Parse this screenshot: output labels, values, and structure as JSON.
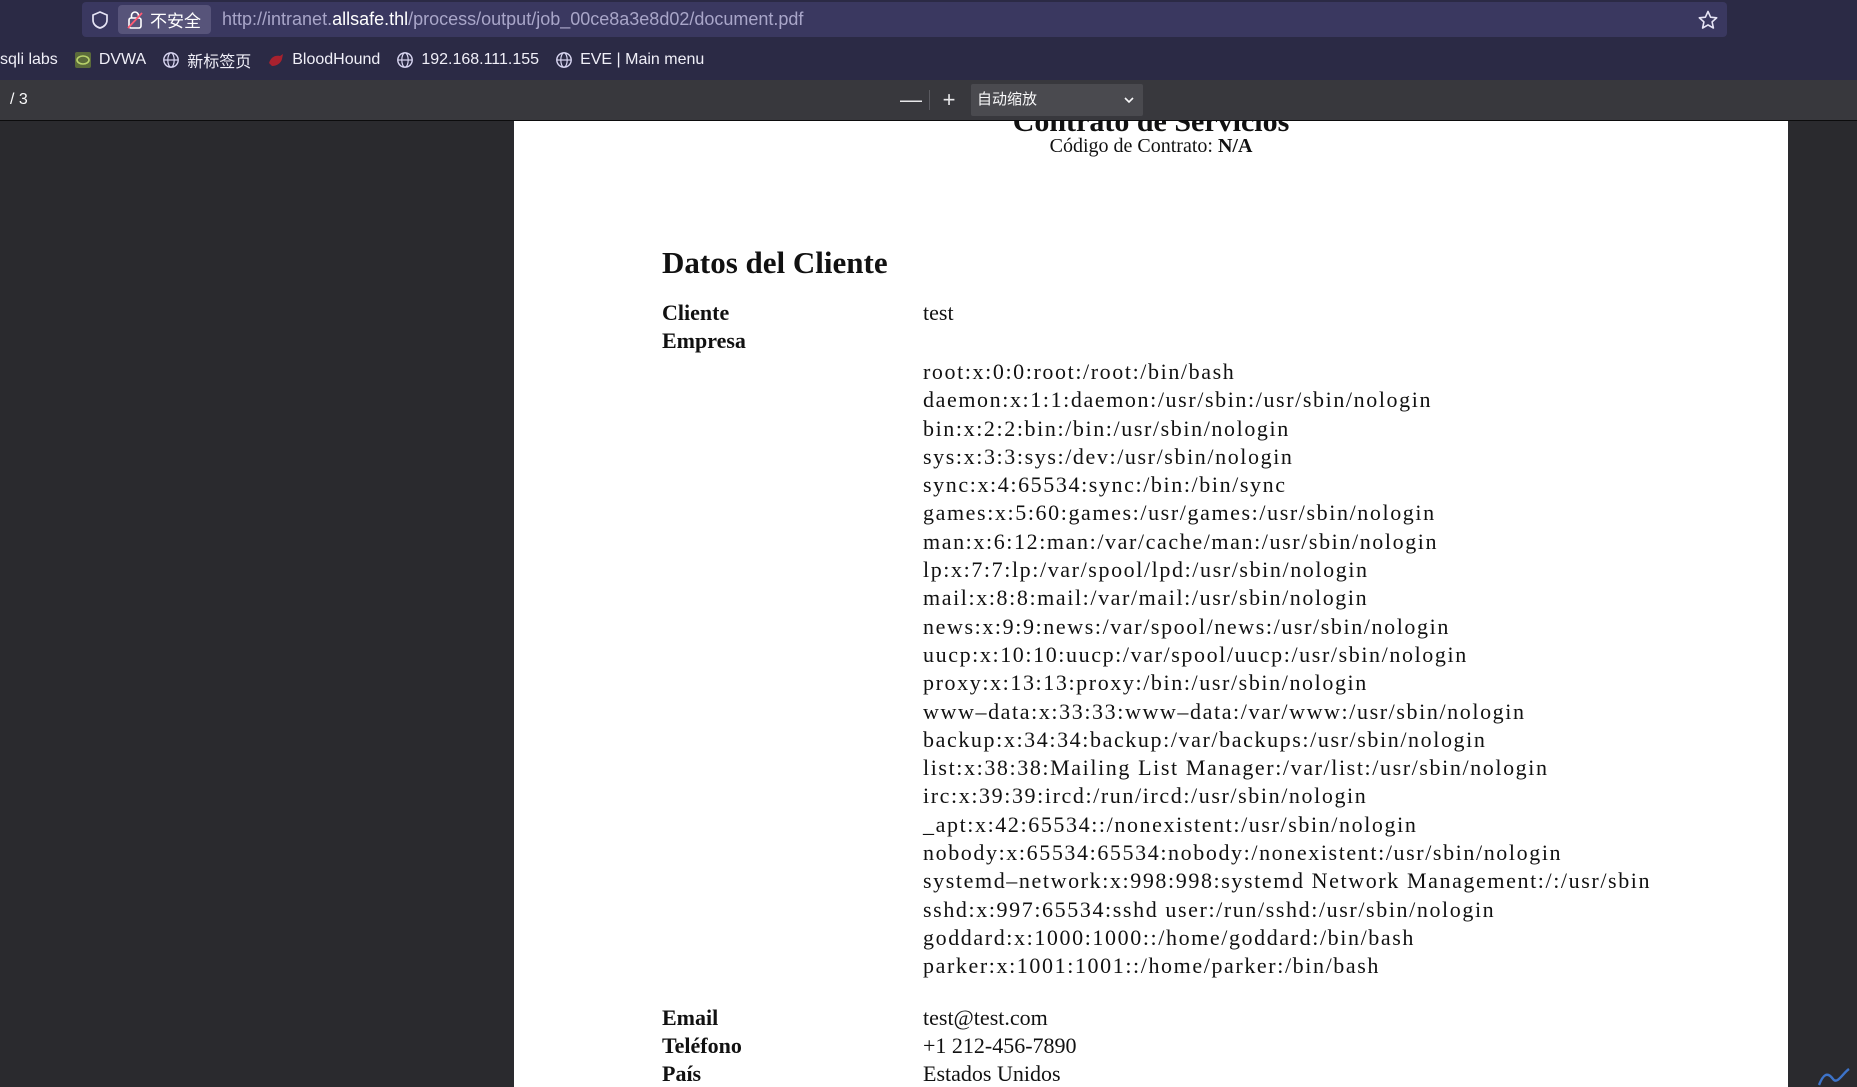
{
  "browser": {
    "security_label": "不安全",
    "url_prefix": "http://intranet.",
    "url_domain": "allsafe.thl",
    "url_path": "/process/output/job_00ce8a3e8d02/document.pdf",
    "bookmarks": [
      {
        "label": "sqli labs",
        "icon": "none"
      },
      {
        "label": "DVWA",
        "icon": "dvwa-icon"
      },
      {
        "label": "新标签页",
        "icon": "globe-icon"
      },
      {
        "label": "BloodHound",
        "icon": "bloodhound-icon"
      },
      {
        "label": "192.168.111.155",
        "icon": "globe-icon"
      },
      {
        "label": "EVE | Main menu",
        "icon": "globe-icon"
      }
    ]
  },
  "pdf_toolbar": {
    "page_count": "/ 3",
    "zoom_out": "—",
    "zoom_in": "+",
    "zoom_value": "自动缩放"
  },
  "document": {
    "title": "Contrato de Servicios",
    "code_label": "Código de Contrato:",
    "code_value": "N/A",
    "section_title": "Datos del Cliente",
    "fields": {
      "cliente_label": "Cliente",
      "cliente_value": "test",
      "empresa_label": "Empresa",
      "email_label": "Email",
      "email_value": "test@test.com",
      "telefono_label": "Teléfono",
      "telefono_value": "+1 212-456-7890",
      "pais_label": "País",
      "pais_value": "Estados Unidos"
    },
    "empresa_lines": [
      "root:x:0:0:root:/root:/bin/bash",
      "daemon:x:1:1:daemon:/usr/sbin:/usr/sbin/nologin",
      "bin:x:2:2:bin:/bin:/usr/sbin/nologin",
      "sys:x:3:3:sys:/dev:/usr/sbin/nologin",
      "sync:x:4:65534:sync:/bin:/bin/sync",
      "games:x:5:60:games:/usr/games:/usr/sbin/nologin",
      "man:x:6:12:man:/var/cache/man:/usr/sbin/nologin",
      "lp:x:7:7:lp:/var/spool/lpd:/usr/sbin/nologin",
      "mail:x:8:8:mail:/var/mail:/usr/sbin/nologin",
      "news:x:9:9:news:/var/spool/news:/usr/sbin/nologin",
      "uucp:x:10:10:uucp:/var/spool/uucp:/usr/sbin/nologin",
      "proxy:x:13:13:proxy:/bin:/usr/sbin/nologin",
      "www–data:x:33:33:www–data:/var/www:/usr/sbin/nologin",
      "backup:x:34:34:backup:/var/backups:/usr/sbin/nologin",
      "list:x:38:38:Mailing List Manager:/var/list:/usr/sbin/nologin",
      "irc:x:39:39:ircd:/run/ircd:/usr/sbin/nologin",
      "_apt:x:42:65534::/nonexistent:/usr/sbin/nologin",
      "nobody:x:65534:65534:nobody:/nonexistent:/usr/sbin/nologin",
      "systemd–network:x:998:998:systemd Network Management:/:/usr/sbin",
      "sshd:x:997:65534:sshd user:/run/sshd:/usr/sbin/nologin",
      "goddard:x:1000:1000::/home/goddard:/bin/bash",
      "parker:x:1001:1001::/home/parker:/bin/bash"
    ]
  },
  "colors": {
    "chrome_bg": "#2b2a45",
    "urlbar_bg": "#3a3860",
    "pdf_toolbar_bg": "#38383d",
    "viewer_bg": "#2a2a2e"
  }
}
